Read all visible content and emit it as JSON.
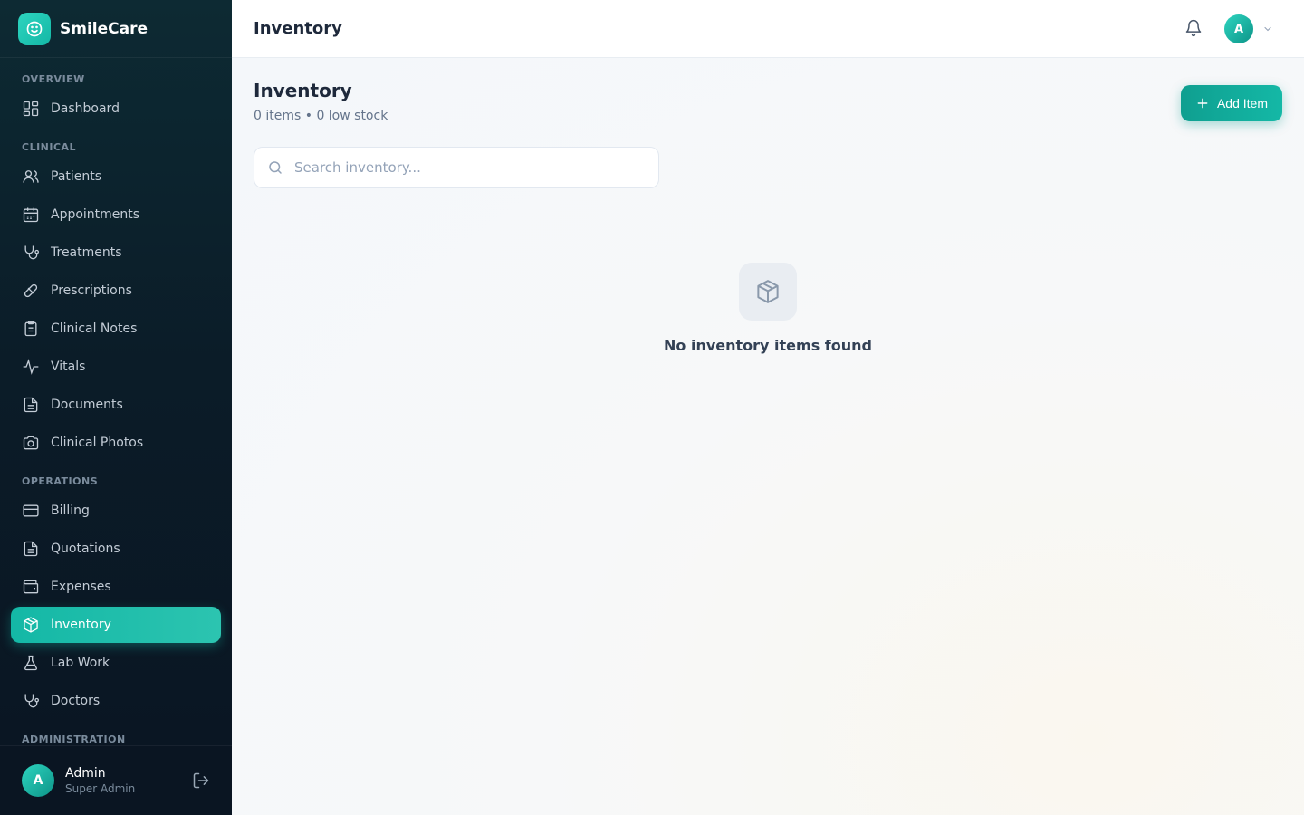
{
  "app": {
    "name": "SmileCare"
  },
  "sidebar": {
    "sections": {
      "overview": "OVERVIEW",
      "clinical": "CLINICAL",
      "operations": "OPERATIONS",
      "administration": "ADMINISTRATION"
    },
    "items": {
      "dashboard": {
        "label": "Dashboard",
        "icon": "layout-grid-icon"
      },
      "patients": {
        "label": "Patients",
        "icon": "users-icon"
      },
      "appointments": {
        "label": "Appointments",
        "icon": "calendar-icon"
      },
      "treatments": {
        "label": "Treatments",
        "icon": "stethoscope-icon"
      },
      "prescriptions": {
        "label": "Prescriptions",
        "icon": "pill-icon"
      },
      "clinical_notes": {
        "label": "Clinical Notes",
        "icon": "clipboard-icon"
      },
      "vitals": {
        "label": "Vitals",
        "icon": "activity-icon"
      },
      "documents": {
        "label": "Documents",
        "icon": "file-text-icon"
      },
      "clinical_photos": {
        "label": "Clinical Photos",
        "icon": "camera-icon"
      },
      "billing": {
        "label": "Billing",
        "icon": "credit-card-icon"
      },
      "quotations": {
        "label": "Quotations",
        "icon": "file-text-icon"
      },
      "expenses": {
        "label": "Expenses",
        "icon": "wallet-icon"
      },
      "inventory": {
        "label": "Inventory",
        "icon": "package-icon",
        "active": true
      },
      "lab_work": {
        "label": "Lab Work",
        "icon": "flask-icon"
      },
      "doctors": {
        "label": "Doctors",
        "icon": "stethoscope-icon"
      }
    },
    "user": {
      "initial": "A",
      "name": "Admin",
      "role": "Super Admin"
    }
  },
  "topbar": {
    "title": "Inventory",
    "avatar_initial": "A"
  },
  "main": {
    "title": "Inventory",
    "subtitle": "0 items • 0 low stock",
    "add_button": "Add Item",
    "search_placeholder": "Search inventory...",
    "empty_message": "No inventory items found"
  },
  "colors": {
    "accent": "#14b8a6",
    "sidebar_bg": "#0b1c28"
  }
}
